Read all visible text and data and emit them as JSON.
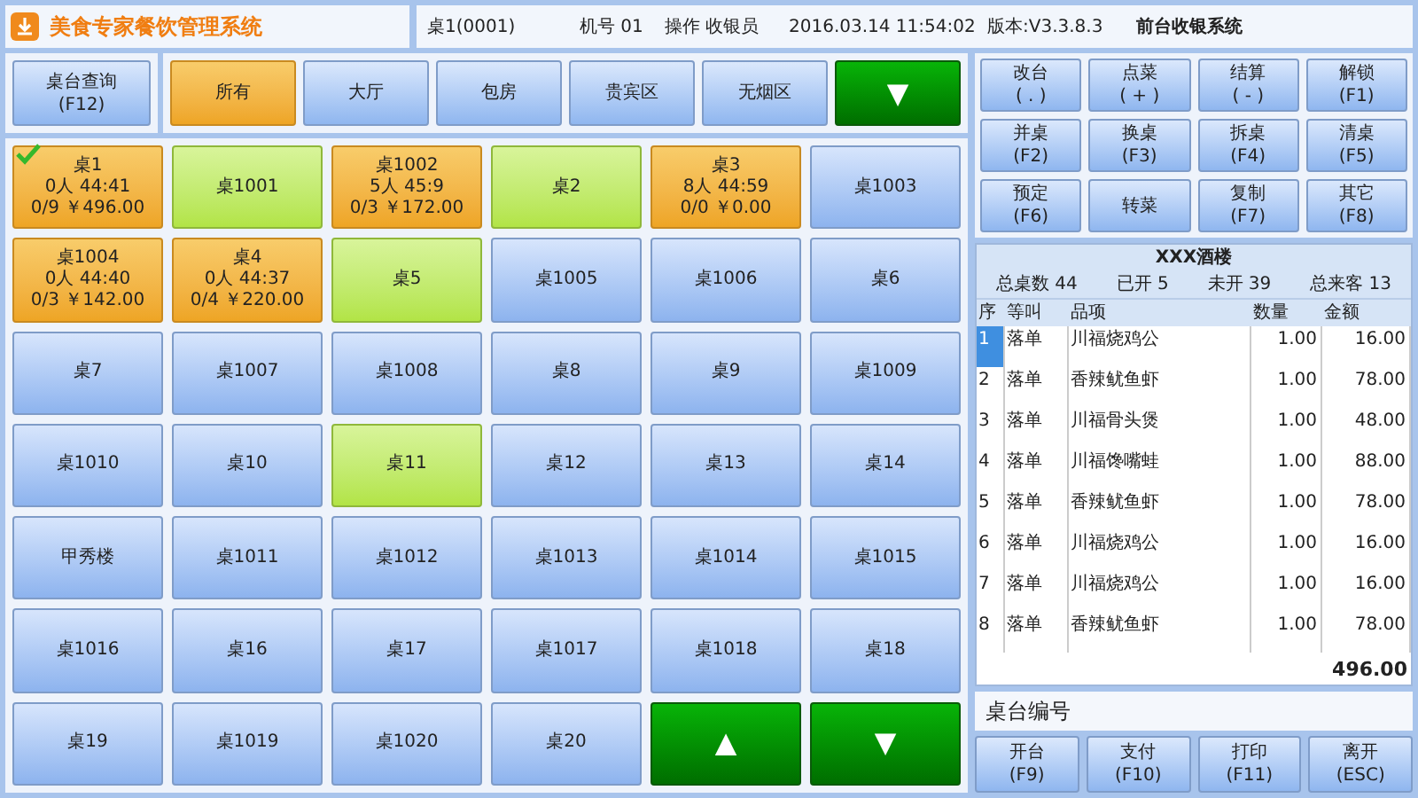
{
  "app_title": "美食专家餐饮管理系统",
  "info_bar": {
    "table": "桌1(0001)",
    "machine": "机号 01",
    "operator": "操作 收银员",
    "datetime": "2016.03.14 11:54:02",
    "version": "版本:V3.3.8.3",
    "system": "前台收银系统"
  },
  "search_button": {
    "label": "桌台查询",
    "key": "(F12)"
  },
  "areas": [
    {
      "label": "所有",
      "selected": true
    },
    {
      "label": "大厅",
      "selected": false
    },
    {
      "label": "包房",
      "selected": false
    },
    {
      "label": "贵宾区",
      "selected": false
    },
    {
      "label": "无烟区",
      "selected": false
    }
  ],
  "area_more": "▼",
  "tables": [
    {
      "name": "桌1",
      "kind": "occupied",
      "selected": true,
      "lines": [
        "0人 44:41",
        "0/9 ￥496.00"
      ]
    },
    {
      "name": "桌1001",
      "kind": "reserved",
      "selected": false
    },
    {
      "name": "桌1002",
      "kind": "occupied",
      "selected": false,
      "lines": [
        "5人 45:9",
        "0/3 ￥172.00"
      ]
    },
    {
      "name": "桌2",
      "kind": "reserved",
      "selected": false
    },
    {
      "name": "桌3",
      "kind": "occupied",
      "selected": false,
      "lines": [
        "8人 44:59",
        "0/0 ￥0.00"
      ]
    },
    {
      "name": "桌1003",
      "kind": "free",
      "selected": false
    },
    {
      "name": "桌1004",
      "kind": "occupied",
      "selected": false,
      "lines": [
        "0人 44:40",
        "0/3 ￥142.00"
      ]
    },
    {
      "name": "桌4",
      "kind": "occupied",
      "selected": false,
      "lines": [
        "0人 44:37",
        "0/4 ￥220.00"
      ]
    },
    {
      "name": "桌5",
      "kind": "reserved",
      "selected": false
    },
    {
      "name": "桌1005",
      "kind": "free",
      "selected": false
    },
    {
      "name": "桌1006",
      "kind": "free",
      "selected": false
    },
    {
      "name": "桌6",
      "kind": "free",
      "selected": false
    },
    {
      "name": "桌7",
      "kind": "free",
      "selected": false
    },
    {
      "name": "桌1007",
      "kind": "free",
      "selected": false
    },
    {
      "name": "桌1008",
      "kind": "free",
      "selected": false
    },
    {
      "name": "桌8",
      "kind": "free",
      "selected": false
    },
    {
      "name": "桌9",
      "kind": "free",
      "selected": false
    },
    {
      "name": "桌1009",
      "kind": "free",
      "selected": false
    },
    {
      "name": "桌1010",
      "kind": "free",
      "selected": false
    },
    {
      "name": "桌10",
      "kind": "free",
      "selected": false
    },
    {
      "name": "桌11",
      "kind": "reserved",
      "selected": false
    },
    {
      "name": "桌12",
      "kind": "free",
      "selected": false
    },
    {
      "name": "桌13",
      "kind": "free",
      "selected": false
    },
    {
      "name": "桌14",
      "kind": "free",
      "selected": false
    },
    {
      "name": "甲秀楼",
      "kind": "free",
      "selected": false
    },
    {
      "name": "桌1011",
      "kind": "free",
      "selected": false
    },
    {
      "name": "桌1012",
      "kind": "free",
      "selected": false
    },
    {
      "name": "桌1013",
      "kind": "free",
      "selected": false
    },
    {
      "name": "桌1014",
      "kind": "free",
      "selected": false
    },
    {
      "name": "桌1015",
      "kind": "free",
      "selected": false
    },
    {
      "name": "桌1016",
      "kind": "free",
      "selected": false
    },
    {
      "name": "桌16",
      "kind": "free",
      "selected": false
    },
    {
      "name": "桌17",
      "kind": "free",
      "selected": false
    },
    {
      "name": "桌1017",
      "kind": "free",
      "selected": false
    },
    {
      "name": "桌1018",
      "kind": "free",
      "selected": false
    },
    {
      "name": "桌18",
      "kind": "free",
      "selected": false
    },
    {
      "name": "桌19",
      "kind": "free",
      "selected": false
    },
    {
      "name": "桌1019",
      "kind": "free",
      "selected": false
    },
    {
      "name": "桌1020",
      "kind": "free",
      "selected": false
    },
    {
      "name": "桌20",
      "kind": "free",
      "selected": false
    }
  ],
  "page_buttons": [
    "▲",
    "▼"
  ],
  "actions": [
    {
      "label": "改台",
      "key": "( . )"
    },
    {
      "label": "点菜",
      "key": "( + )"
    },
    {
      "label": "结算",
      "key": "( - )"
    },
    {
      "label": "解锁",
      "key": "(F1)"
    },
    {
      "label": "并桌",
      "key": "(F2)"
    },
    {
      "label": "换桌",
      "key": "(F3)"
    },
    {
      "label": "拆桌",
      "key": "(F4)"
    },
    {
      "label": "清桌",
      "key": "(F5)"
    },
    {
      "label": "预定",
      "key": "(F6)"
    },
    {
      "label": "转菜"
    },
    {
      "label": "复制",
      "key": "(F7)"
    },
    {
      "label": "其它",
      "key": "(F8)"
    }
  ],
  "order": {
    "restaurant": "XXX酒楼",
    "stats": [
      "总桌数 44",
      "已开 5",
      "未开 39",
      "总来客 13"
    ],
    "columns": [
      "序",
      "等叫",
      "品项",
      "数量",
      "金额"
    ],
    "rows": [
      {
        "cells": [
          "1",
          "落单",
          "川福烧鸡公",
          "1.00",
          "16.00"
        ],
        "selected": true
      },
      {
        "cells": [
          "2",
          "落单",
          "香辣鱿鱼虾",
          "1.00",
          "78.00"
        ],
        "selected": false
      },
      {
        "cells": [
          "3",
          "落单",
          "川福骨头煲",
          "1.00",
          "48.00"
        ],
        "selected": false
      },
      {
        "cells": [
          "4",
          "落单",
          "川福馋嘴蛙",
          "1.00",
          "88.00"
        ],
        "selected": false
      },
      {
        "cells": [
          "5",
          "落单",
          "香辣鱿鱼虾",
          "1.00",
          "78.00"
        ],
        "selected": false
      },
      {
        "cells": [
          "6",
          "落单",
          "川福烧鸡公",
          "1.00",
          "16.00"
        ],
        "selected": false
      },
      {
        "cells": [
          "7",
          "落单",
          "川福烧鸡公",
          "1.00",
          "16.00"
        ],
        "selected": false
      },
      {
        "cells": [
          "8",
          "落单",
          "香辣鱿鱼虾",
          "1.00",
          "78.00"
        ],
        "selected": false
      }
    ],
    "total": "496.00"
  },
  "table_number_label": "桌台编号",
  "bottom_buttons": [
    {
      "label": "开台",
      "key": "(F9)"
    },
    {
      "label": "支付",
      "key": "(F10)"
    },
    {
      "label": "打印",
      "key": "(F11)"
    },
    {
      "label": "离开",
      "key": "(ESC)"
    }
  ]
}
